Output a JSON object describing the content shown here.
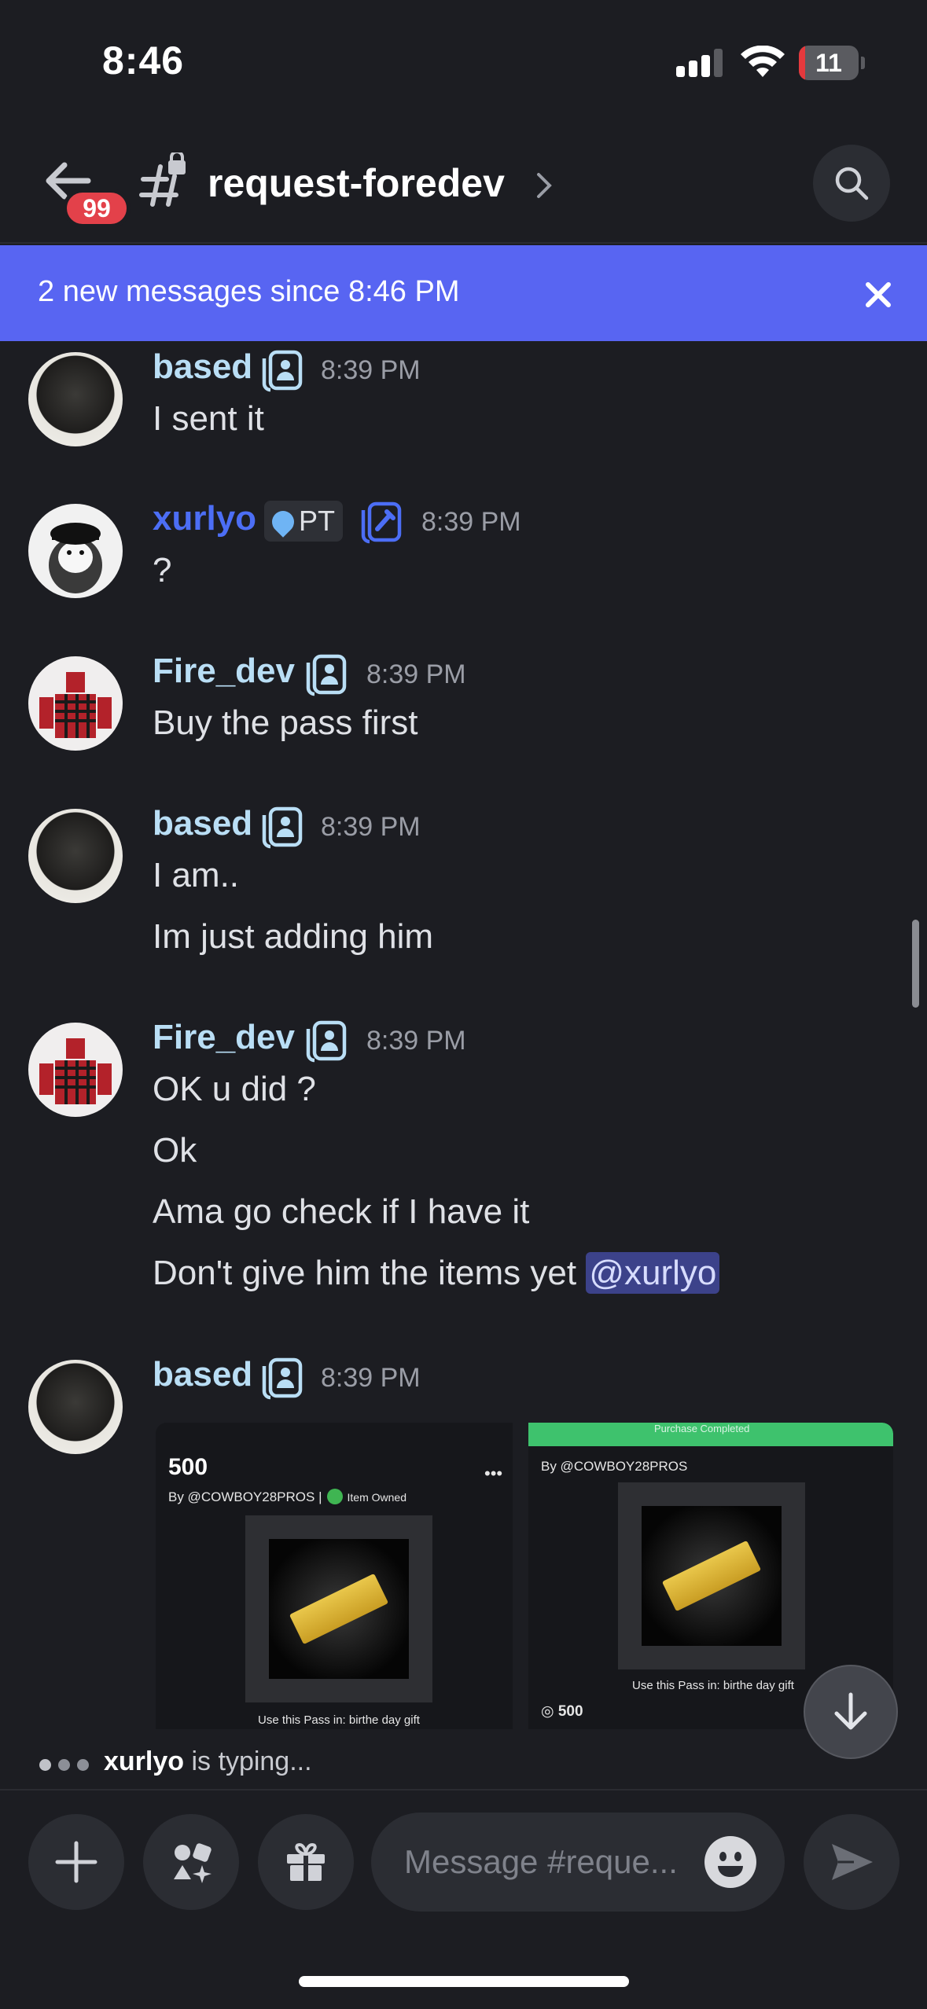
{
  "status_bar": {
    "time": "8:46",
    "battery": "11",
    "battery_level": 0.11
  },
  "header": {
    "unread_badge": "99",
    "channel_name": "request-foredev",
    "icons": [
      "back-arrow-icon",
      "locked-hash-icon",
      "chevron-right-icon",
      "search-icon"
    ]
  },
  "banner": {
    "text": "2 new messages since 8:46 PM"
  },
  "messages": [
    {
      "author": "based",
      "time": "8:39 PM",
      "lines": [
        "I sent it"
      ]
    },
    {
      "author": "xurlyo",
      "tag": "PT",
      "time": "8:39 PM",
      "lines": [
        "?"
      ]
    },
    {
      "author": "Fire_dev",
      "time": "8:39 PM",
      "lines": [
        "Buy the pass first"
      ]
    },
    {
      "author": "based",
      "time": "8:39 PM",
      "lines": [
        "I am..",
        "Im just adding him"
      ]
    },
    {
      "author": "Fire_dev",
      "time": "8:39 PM",
      "lines": [
        "OK u did ?",
        "Ok",
        "Ama go check if I have it",
        "Don't give him the items yet"
      ],
      "mention": "@xurlyo"
    },
    {
      "author": "based",
      "time": "8:39 PM",
      "lines": []
    }
  ],
  "attachments": [
    {
      "price": "500",
      "by": "By @COWBOY28PROS |",
      "owned": "Item Owned",
      "use_text": "Use this Pass in: birthe day gift"
    },
    {
      "banner": "Purchase Completed",
      "by": "By @COWBOY28PROS",
      "use_text": "Use this Pass in: birthe day gift",
      "price": "500"
    }
  ],
  "typing": {
    "user": "xurlyo",
    "text": " is typing..."
  },
  "composer": {
    "placeholder": "Message #reque..."
  }
}
